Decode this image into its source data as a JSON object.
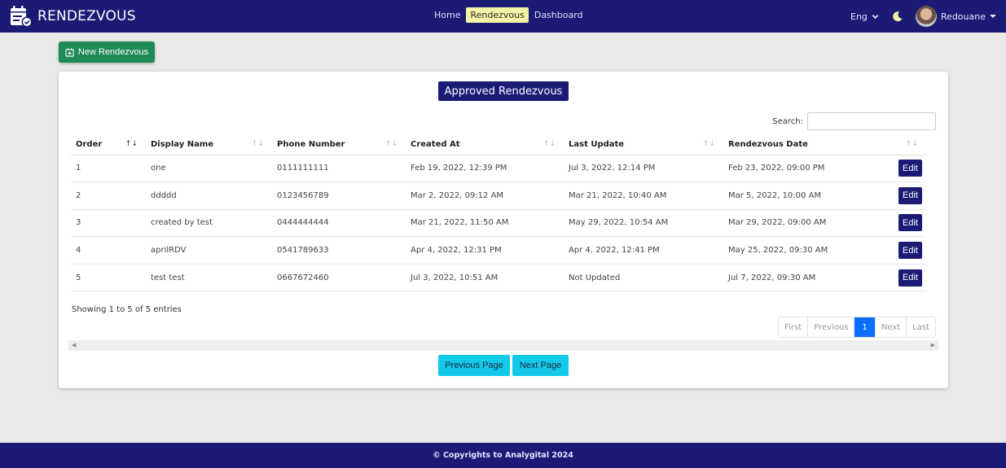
{
  "app": {
    "brand": "RENDEZVOUS",
    "brand_icon": "calendar-check-icon"
  },
  "nav": {
    "links": [
      {
        "label": "Home",
        "active": false
      },
      {
        "label": "Rendezvous",
        "active": true
      },
      {
        "label": "Dashboard",
        "active": false
      }
    ],
    "language": "Eng",
    "theme_icon": "moon-icon",
    "username": "Redouane"
  },
  "toolbar": {
    "new_label": "New Rendezvous"
  },
  "card": {
    "title": "Approved Rendezvous",
    "search_label": "Search:",
    "search_value": "",
    "columns": [
      "Order",
      "Display Name",
      "Phone Number",
      "Created At",
      "Last Update",
      "Rendezvous Date",
      ""
    ],
    "rows": [
      {
        "order": "1",
        "name": "one",
        "phone": "0111111111",
        "created": "Feb 19, 2022, 12:39 PM",
        "updated": "Jul 3, 2022, 12:14 PM",
        "date": "Feb 23, 2022, 09:00 PM",
        "action": "Edit"
      },
      {
        "order": "2",
        "name": "ddddd",
        "phone": "0123456789",
        "created": "Mar 2, 2022, 09:12 AM",
        "updated": "Mar 21, 2022, 10:40 AM",
        "date": "Mar 5, 2022, 10:00 AM",
        "action": "Edit"
      },
      {
        "order": "3",
        "name": "created by test",
        "phone": "0444444444",
        "created": "Mar 21, 2022, 11:50 AM",
        "updated": "May 29, 2022, 10:54 AM",
        "date": "Mar 29, 2022, 09:00 AM",
        "action": "Edit"
      },
      {
        "order": "4",
        "name": "aprilRDV",
        "phone": "0541789633",
        "created": "Apr 4, 2022, 12:31 PM",
        "updated": "Apr 4, 2022, 12:41 PM",
        "date": "May 25, 2022, 09:30 AM",
        "action": "Edit"
      },
      {
        "order": "5",
        "name": "test test",
        "phone": "0667672460",
        "created": "Jul 3, 2022, 10:51 AM",
        "updated": "Not Updated",
        "date": "Jul 7, 2022, 09:30 AM",
        "action": "Edit"
      }
    ],
    "info": "Showing 1 to 5 of 5 entries",
    "pagination": [
      "First",
      "Previous",
      "1",
      "Next",
      "Last"
    ],
    "current_page": "1",
    "prev_page_label": "Previous Page",
    "next_page_label": "Next Page"
  },
  "footer": {
    "text": "© Copyrights to Analygital 2024"
  },
  "colors": {
    "navbar": "#1b1a75",
    "active_nav": "#f5f3a5",
    "new_button": "#1e8a57",
    "edit_button": "#1b1a75",
    "page_button": "#13c9ea",
    "pagination_active": "#0d6efd"
  }
}
